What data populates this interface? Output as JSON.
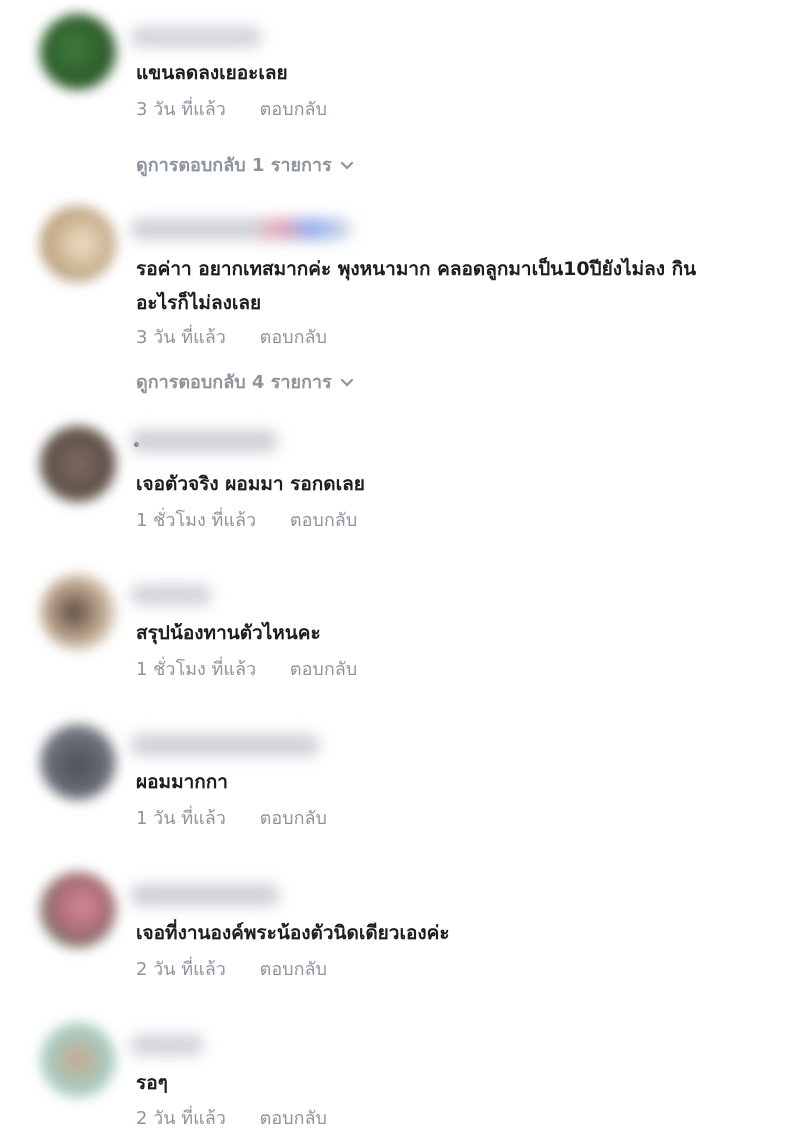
{
  "colors": {
    "meta_text": "#8d949e",
    "comment_text": "#1c1e21"
  },
  "comments": [
    {
      "text": "แขนลดลงเยอะเลย",
      "time": "3 วัน ที่แล้ว",
      "reply": "ตอบกลับ",
      "view_replies": "ดูการตอบกลับ 1 รายการ"
    },
    {
      "text": "รอค่าา อยากเทสมากค่ะ พุงหนามาก คลอดลูกมาเป็น10ปียังไม่ลง กิน\nอะไรก็ไม่ลงเลย",
      "time": "3 วัน ที่แล้ว",
      "reply": "ตอบกลับ",
      "view_replies": "ดูการตอบกลับ 4 รายการ"
    },
    {
      "text": "เจอตัวจริง ผอมมา รอกดเลย",
      "time": "1 ชั่วโมง ที่แล้ว",
      "reply": "ตอบกลับ"
    },
    {
      "text": "สรุปน้องทานตัวไหนคะ",
      "time": "1 ชั่วโมง ที่แล้ว",
      "reply": "ตอบกลับ"
    },
    {
      "text": "ผอมมากกา",
      "time": "1 วัน ที่แล้ว",
      "reply": "ตอบกลับ"
    },
    {
      "text": "เจอที่งานองค์พระน้องตัวนิดเดียวเองค่ะ",
      "time": "2 วัน ที่แล้ว",
      "reply": "ตอบกลับ"
    },
    {
      "text": "รอๆ",
      "time": "2 วัน ที่แล้ว",
      "reply": "ตอบกลับ"
    }
  ]
}
